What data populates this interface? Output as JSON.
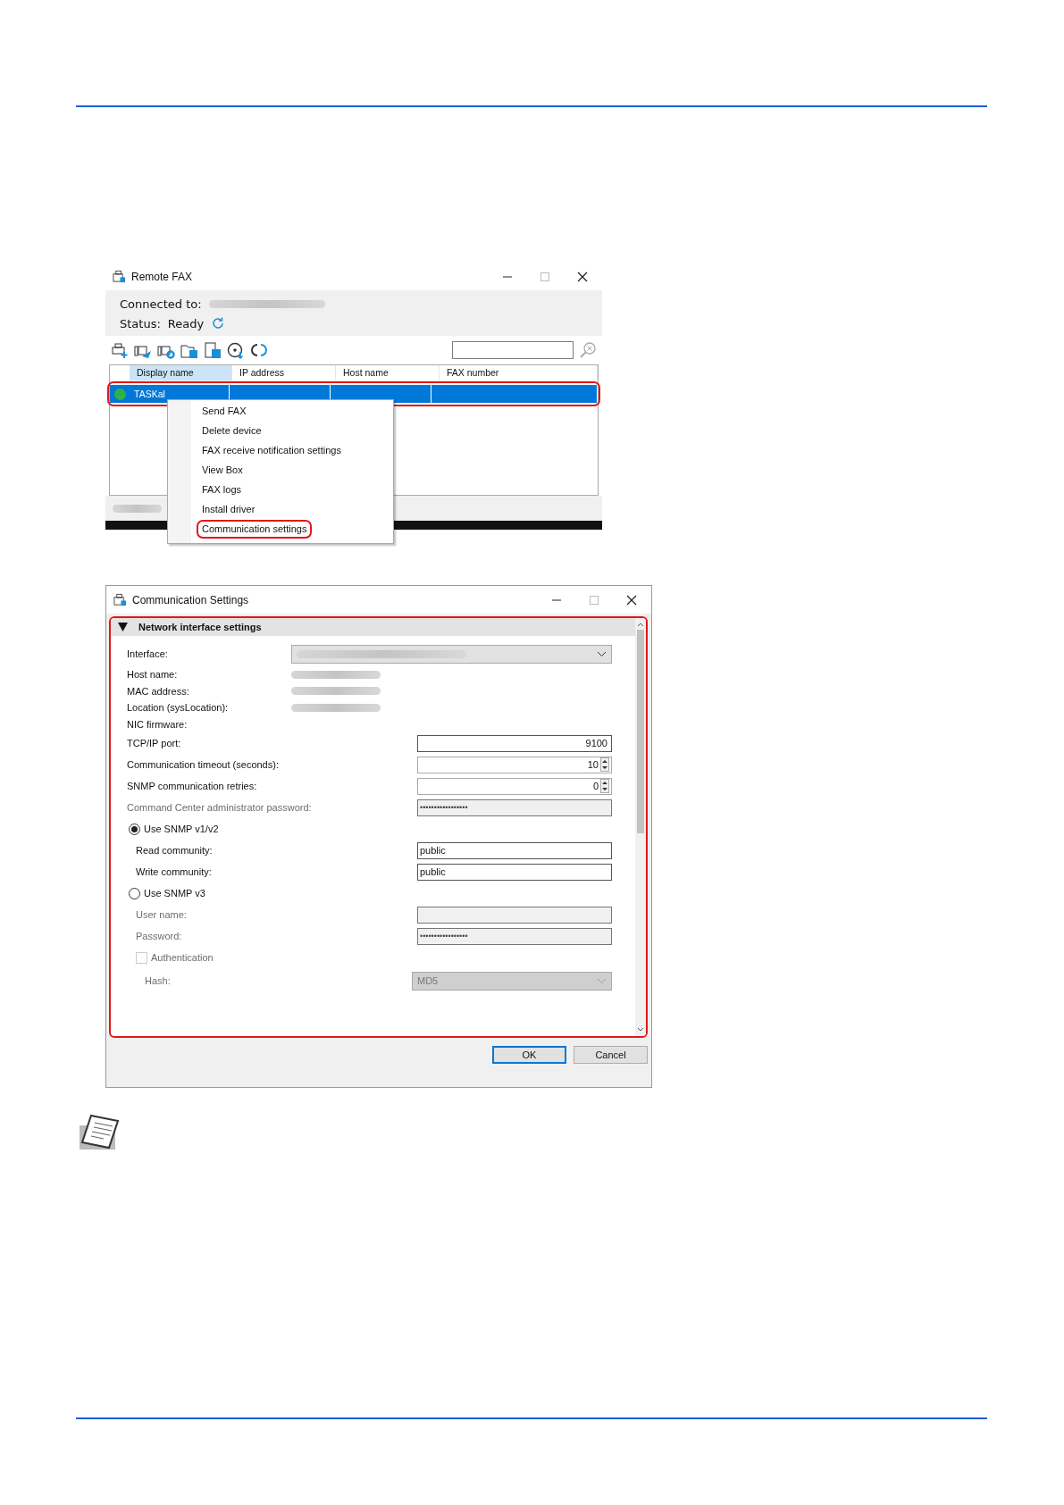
{
  "remote_fax_window": {
    "title": "Remote FAX",
    "connected_label": "Connected to:",
    "status_label": "Status:",
    "status_value": "Ready",
    "device_list": {
      "columns": [
        {
          "label": "Display name",
          "sorted": true
        },
        {
          "label": "IP address",
          "sorted": false
        },
        {
          "label": "Host name",
          "sorted": false
        },
        {
          "label": "FAX number",
          "sorted": false
        }
      ],
      "rows": [
        {
          "display_name": "TASKal",
          "selected": true,
          "highlighted": true,
          "color": "#2eb24b"
        }
      ]
    },
    "context_menu": {
      "items": [
        {
          "label": "Send FAX",
          "highlighted": false
        },
        {
          "label": "Delete device",
          "highlighted": false
        },
        {
          "label": "FAX receive notification settings",
          "highlighted": false
        },
        {
          "label": "View Box",
          "highlighted": false
        },
        {
          "label": "FAX logs",
          "highlighted": false
        },
        {
          "label": "Install driver",
          "highlighted": false
        },
        {
          "label": "Communication settings",
          "highlighted": true
        }
      ]
    }
  },
  "communication_settings_window": {
    "title": "Communication Settings",
    "highlighted": true,
    "section": {
      "title": "Network interface settings",
      "expanded": true,
      "items": [
        {
          "kind": "dropdown",
          "label": "Interface:",
          "disabled": false
        },
        {
          "kind": "info",
          "label": "Host name:",
          "hidden_value": true
        },
        {
          "kind": "info",
          "label": "MAC address:",
          "hidden_value": true
        },
        {
          "kind": "info",
          "label": "Location (sysLocation):",
          "hidden_value": true
        },
        {
          "kind": "info",
          "label": "NIC firmware:"
        },
        {
          "kind": "number",
          "label": "TCP/IP port:",
          "value": "9100",
          "disabled": false
        },
        {
          "kind": "spinner",
          "label": "Communication timeout (seconds):",
          "value": "10",
          "disabled": false
        },
        {
          "kind": "spinner",
          "label": "SNMP communication retries:",
          "value": "0",
          "disabled": false
        },
        {
          "kind": "password",
          "label": "Command Center administrator password:",
          "value": "•••••••••••••••••",
          "disabled": true
        },
        {
          "kind": "radio",
          "label": "Use SNMP v1/v2",
          "selected": true,
          "children": [
            {
              "kind": "text",
              "label": "Read community:",
              "value": "public",
              "disabled": false
            },
            {
              "kind": "text",
              "label": "Write community:",
              "value": "public",
              "disabled": false
            }
          ]
        },
        {
          "kind": "radio",
          "label": "Use SNMP v3",
          "selected": false,
          "children": [
            {
              "kind": "text",
              "label": "User name:",
              "disabled": true
            },
            {
              "kind": "password",
              "label": "Password:",
              "value": "•••••••••••••••••",
              "disabled": true
            },
            {
              "kind": "checkbox",
              "label": "Authentication",
              "checked": false,
              "disabled": true,
              "children": [
                {
                  "kind": "dropdown",
                  "label": "Hash:",
                  "value": "MD5",
                  "disabled": true
                }
              ]
            }
          ]
        }
      ]
    },
    "buttons": [
      {
        "label": "OK",
        "default": true
      },
      {
        "label": "Cancel",
        "default": false
      }
    ]
  }
}
